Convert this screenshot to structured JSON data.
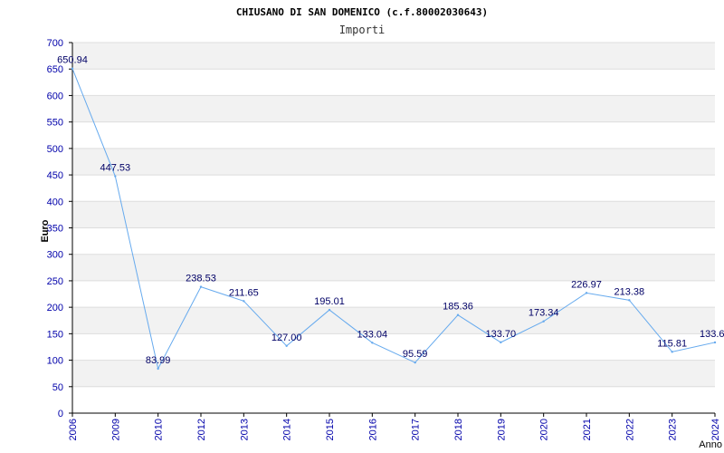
{
  "chart_data": {
    "type": "line",
    "title": "CHIUSANO DI SAN DOMENICO (c.f.80002030643)",
    "subtitle": "Importi",
    "ylabel": "Euro",
    "xlabel": "Anno",
    "ylim": [
      0,
      700
    ],
    "yticks": [
      0,
      50,
      100,
      150,
      200,
      250,
      300,
      350,
      400,
      450,
      500,
      550,
      600,
      650,
      700
    ],
    "categories": [
      "2006",
      "2009",
      "2010",
      "2012",
      "2013",
      "2014",
      "2015",
      "2016",
      "2017",
      "2018",
      "2019",
      "2020",
      "2021",
      "2022",
      "2023",
      "2024"
    ],
    "series": [
      {
        "values": [
          650.94,
          447.53,
          83.99,
          238.53,
          211.65,
          127.0,
          195.01,
          133.04,
          95.59,
          185.36,
          133.7,
          173.34,
          226.97,
          213.38,
          115.81,
          133.6
        ],
        "labels": [
          "650.94",
          "447.53",
          "83.99",
          "238.53",
          "211.65",
          "127.00",
          "195.01",
          "133.04",
          "95.59",
          "185.36",
          "133.70",
          "173.34",
          "226.97",
          "213.38",
          "115.81",
          "133.6"
        ]
      }
    ],
    "grid": true,
    "banded_background": true,
    "legend": "none",
    "colors": {
      "line": "#66aaee",
      "tick_text": "#0000aa",
      "data_label": "#000066",
      "band": "#f2f2f2",
      "grid": "#dddddd"
    }
  }
}
